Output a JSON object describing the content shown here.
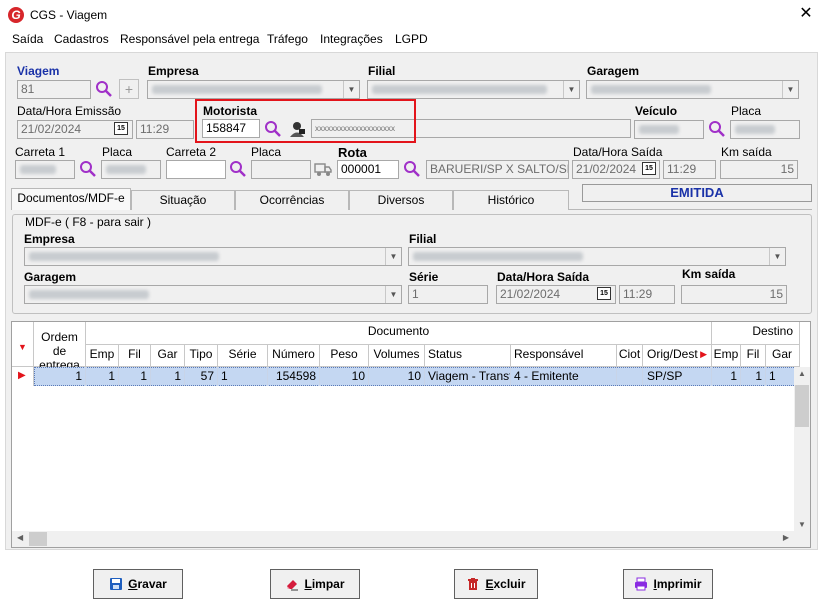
{
  "window": {
    "title": "CGS - Viagem",
    "app_icon": "G"
  },
  "menu": [
    "Saída",
    "Cadastros",
    "Responsável pela entrega",
    "Tráfego",
    "Integrações",
    "LGPD"
  ],
  "header": {
    "viagem_label": "Viagem",
    "viagem_value": "81",
    "empresa_label": "Empresa",
    "filial_label": "Filial",
    "garagem_label": "Garagem",
    "data_emissao_label": "Data/Hora Emissão",
    "data_emissao_date": "21/02/2024",
    "data_emissao_time": "11:29",
    "motorista_label": "Motorista",
    "motorista_value": "158847",
    "motorista_name": "xxxxxxxxxxxxxxxxxxxx",
    "veiculo_label": "Veículo",
    "placa_label": "Placa",
    "carreta1_label": "Carreta 1",
    "placa1_label": "Placa",
    "carreta2_label": "Carreta 2",
    "placa2_label": "Placa",
    "rota_label": "Rota",
    "rota_value": "000001",
    "rota_desc": "BARUERI/SP X SALTO/SP",
    "data_saida_label": "Data/Hora Saída",
    "data_saida_date": "21/02/2024",
    "data_saida_time": "11:29",
    "km_saida_label": "Km saída",
    "km_saida_value": "15",
    "calendar_glyph": "15"
  },
  "tabs": [
    {
      "label": "Documentos/MDF-e",
      "active": true
    },
    {
      "label": "Situação"
    },
    {
      "label": "Ocorrências"
    },
    {
      "label": "Diversos"
    },
    {
      "label": "Histórico"
    }
  ],
  "status": "EMITIDA",
  "mdfe": {
    "group_title": "MDF-e ( F8 - para sair )",
    "empresa_label": "Empresa",
    "filial_label": "Filial",
    "garagem_label": "Garagem",
    "serie_label": "Série",
    "serie_value": "1",
    "data_saida_label": "Data/Hora Saída",
    "data_saida_date": "21/02/2024",
    "data_saida_time": "11:29",
    "km_saida_label": "Km saída",
    "km_saida_value": "15"
  },
  "grid": {
    "group_headers": {
      "ordem": "Ordem de entrega",
      "documento": "Documento",
      "destino": "Destino"
    },
    "columns": [
      "Emp",
      "Fil",
      "Gar",
      "Tipo",
      "Série",
      "Número",
      "Peso",
      "Volumes",
      "Status",
      "Responsável seguro",
      "Ciot",
      "Orig/Dest",
      "Emp",
      "Fil",
      "Gar"
    ],
    "rows": [
      [
        "1",
        "1",
        "1",
        "1",
        "57",
        "1",
        "154598",
        "10",
        "10",
        "Viagem - Transf...",
        "4 - Emitente",
        "",
        "SP/SP",
        "1",
        "1",
        "1"
      ]
    ]
  },
  "buttons": [
    {
      "label": "Gravar",
      "accel": "G",
      "icon": "floppy-icon",
      "color": "#1f5fbf"
    },
    {
      "label": "Limpar",
      "accel": "L",
      "icon": "eraser-icon",
      "color": "#d41c3c"
    },
    {
      "label": "Excluir",
      "accel": "E",
      "icon": "trash-icon",
      "color": "#c62828"
    },
    {
      "label": "Imprimir",
      "accel": "I",
      "icon": "printer-icon",
      "color": "#8a2be2"
    }
  ],
  "colors": {
    "accent_blue": "#1a32a8",
    "selected_row": "#c4d7f2",
    "highlight_red": "#e3141b"
  }
}
